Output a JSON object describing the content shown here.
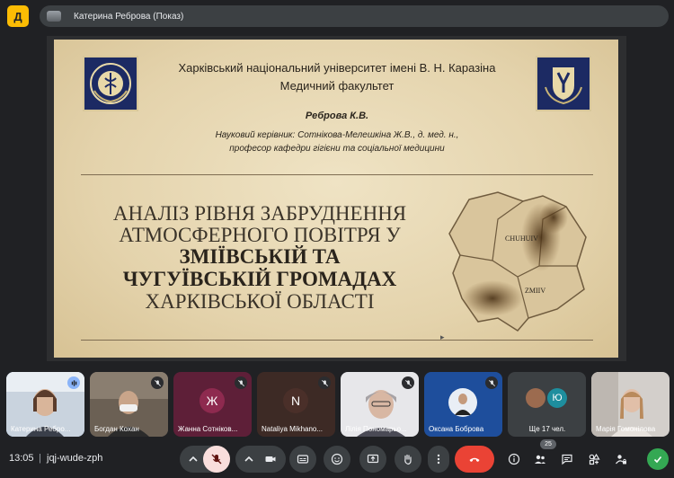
{
  "app": {
    "logo_text": "Д"
  },
  "header": {
    "presenter_label": "Катерина Реброва (Показ)"
  },
  "slide": {
    "university": "Харківський національний університет імені В. Н. Каразіна",
    "faculty": "Медичний факультет",
    "author": "Реброва К.В.",
    "advisor_line1": "Науковий керівник: Сотнікова-Мелешкіна Ж.В., д. мед. н.,",
    "advisor_line2": "професор кафедри гігієни та соціальної медицини",
    "title_lines": [
      "АНАЛІЗ РІВНЯ ЗАБРУДНЕННЯ",
      "АТМОСФЕРНОГО ПОВІТРЯ У",
      "ЗМІЇВСЬКІЙ ТА",
      "ЧУГУЇВСЬКІЙ ГРОМАДАХ",
      "ХАРКІВСЬКОЇ ОБЛАСТІ"
    ],
    "map_labels": [
      "CHUHUIV",
      "ZMIIV"
    ]
  },
  "participants": [
    {
      "name": "Катерина Ребро...",
      "type": "video",
      "speaking": true
    },
    {
      "name": "Богдан Кохан",
      "type": "video",
      "muted": true
    },
    {
      "name": "Жанна Сотніков...",
      "type": "letter",
      "letter": "Ж",
      "color": "#8e2a4f",
      "muted": true
    },
    {
      "name": "Nataliya Mikhano...",
      "type": "letter",
      "letter": "N",
      "color": "#4a2f29",
      "muted": true
    },
    {
      "name": "Лілія Пономарьо...",
      "type": "video",
      "muted": true
    },
    {
      "name": "Оксана Боброва",
      "type": "video",
      "muted": true
    },
    {
      "name": "Ще 17 чел.",
      "type": "more",
      "letter": "Ю"
    },
    {
      "name": "Марія Гомонілова",
      "type": "video"
    }
  ],
  "footer": {
    "time": "13:05",
    "separator": "|",
    "meeting_code": "jqj-wude-zph",
    "people_count": "25"
  },
  "colors": {
    "end_call": "#ea4335",
    "mic_off": "#f9dedc",
    "accent": "#8ab4f8"
  }
}
